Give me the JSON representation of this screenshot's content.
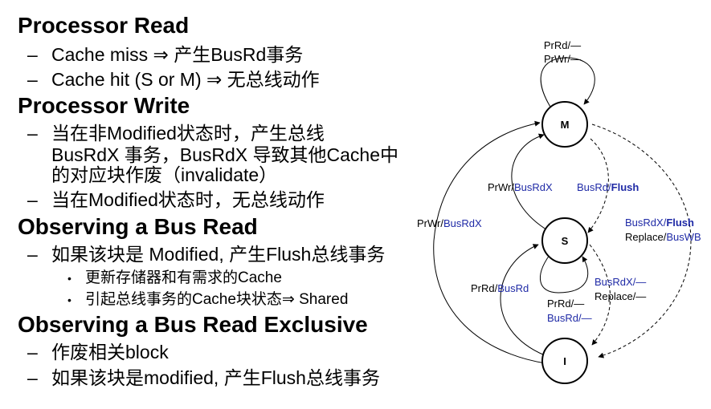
{
  "text": {
    "h1": "Processor Read",
    "h1_b1": "Cache miss ⇒ 产生BusRd事务",
    "h1_b2": "Cache hit  (S or M) ⇒ 无总线动作",
    "h2": "Processor Write",
    "h2_b1_l1": "当在非Modified状态时，产生总线",
    "h2_b1_l2": "BusRdX 事务，BusRdX 导致其他Cache中",
    "h2_b1_l3": "的对应块作废（invalidate）",
    "h2_b2": "当在Modified状态时，无总线动作",
    "h3": "Observing a Bus Read",
    "h3_b1": "如果该块是 Modified, 产生Flush总线事务",
    "h3_s1": "更新存储器和有需求的Cache",
    "h3_s2": "引起总线事务的Cache块状态⇒ Shared",
    "h4": "Observing a Bus Read Exclusive",
    "h4_b1": "作废相关block",
    "h4_b2": "如果该块是modified, 产生Flush总线事务",
    "dash": "–",
    "dot": "•"
  },
  "diagram": {
    "states": {
      "m": "M",
      "s": "S",
      "i": "I"
    },
    "m_loop_1": "PrRd/—",
    "m_loop_2": "PrWr/—",
    "s_to_m_a": "PrWr/",
    "s_to_m_b": "BusRdX",
    "m_to_s_a": "BusRd/",
    "m_to_s_b": "Flush",
    "i_to_m_a": "PrWr/",
    "i_to_m_b": "BusRdX",
    "m_to_i_1a": "BusRdX/",
    "m_to_i_1b": "Flush",
    "m_to_i_2a": "Replace/",
    "m_to_i_2b": "BusWB",
    "i_to_s_a": "PrRd/",
    "i_to_s_b": "BusRd",
    "s_to_i_1": "BusRdX/—",
    "s_to_i_2": "Replace/—",
    "s_loop_1": "PrRd/—",
    "s_loop_2": "BusRd/—",
    "colors": {
      "blue": "#1f2aa6",
      "black": "#000000"
    }
  }
}
